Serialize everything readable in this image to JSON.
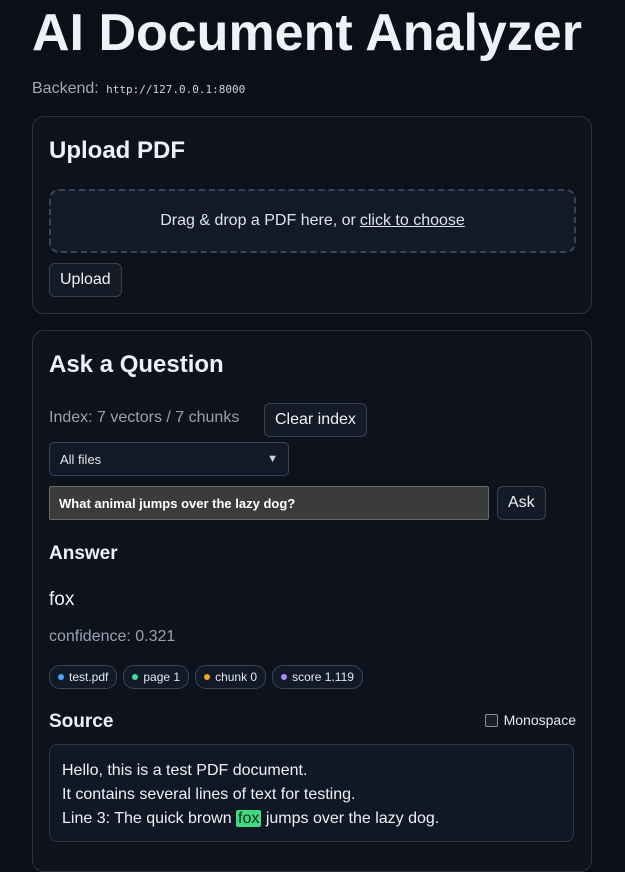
{
  "app": {
    "title": "AI Document Analyzer",
    "backend_label": "Backend:",
    "backend_url": "http://127.0.0.1:8000"
  },
  "upload": {
    "heading": "Upload PDF",
    "dropzone_text": "Drag & drop a PDF here, or",
    "dropzone_link": "click to choose",
    "upload_button": "Upload"
  },
  "ask": {
    "heading": "Ask a Question",
    "index_status": "Index: 7 vectors / 7 chunks",
    "clear_button": "Clear index",
    "file_filter": {
      "selected": "All files"
    },
    "question_value": "What animal jumps over the lazy dog?",
    "ask_button": "Ask"
  },
  "answer": {
    "heading": "Answer",
    "text": "fox",
    "confidence": "confidence: 0.321",
    "badges": [
      {
        "label": "test.pdf",
        "color": "#4ea1ff"
      },
      {
        "label": "page 1",
        "color": "#3ddc97"
      },
      {
        "label": "chunk 0",
        "color": "#f5a524"
      },
      {
        "label": "score 1.119",
        "color": "#a78bfa"
      }
    ]
  },
  "source": {
    "heading": "Source",
    "monospace_label": "Monospace",
    "line1": "Hello, this is a test PDF document.",
    "line2": "It contains several lines of text for testing.",
    "line3_before": "Line 3: The quick brown",
    "line3_highlight": "fox",
    "line3_after": "jumps over the lazy dog.",
    "highlight_color": "#3ddc84"
  }
}
